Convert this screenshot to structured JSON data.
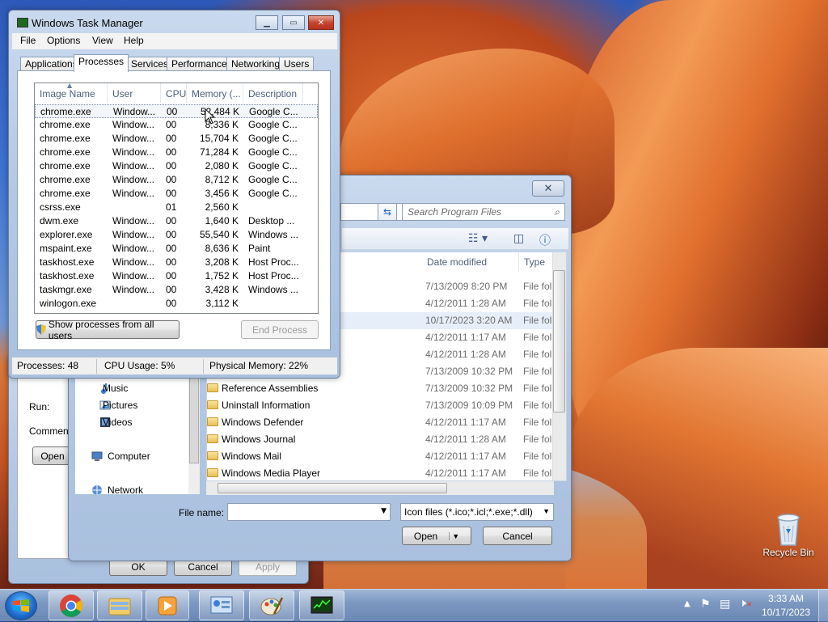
{
  "desktop": {
    "recycle_bin_label": "Recycle Bin"
  },
  "taskbar": {
    "apps": [
      {
        "icon": "chrome-icon"
      },
      {
        "icon": "explorer-folder-icon"
      },
      {
        "icon": "media-player-icon"
      },
      {
        "icon": "control-panel-icon"
      },
      {
        "icon": "paint-icon"
      },
      {
        "icon": "task-manager-icon"
      }
    ],
    "clock_time": "3:33 AM",
    "clock_date": "10/17/2023"
  },
  "task_manager": {
    "title": "Windows Task Manager",
    "menu": [
      "File",
      "Options",
      "View",
      "Help"
    ],
    "tabs": [
      "Applications",
      "Processes",
      "Services",
      "Performance",
      "Networking",
      "Users"
    ],
    "active_tab": "Processes",
    "columns": [
      "Image Name",
      "User Name",
      "CPU",
      "Memory (...",
      "Description"
    ],
    "processes": [
      [
        "chrome.exe",
        "Window...",
        "00",
        "52,484 K",
        "Google C..."
      ],
      [
        "chrome.exe",
        "Window...",
        "00",
        "8,336 K",
        "Google C..."
      ],
      [
        "chrome.exe",
        "Window...",
        "00",
        "15,704 K",
        "Google C..."
      ],
      [
        "chrome.exe",
        "Window...",
        "00",
        "71,284 K",
        "Google C..."
      ],
      [
        "chrome.exe",
        "Window...",
        "00",
        "2,080 K",
        "Google C..."
      ],
      [
        "chrome.exe",
        "Window...",
        "00",
        "8,712 K",
        "Google C..."
      ],
      [
        "chrome.exe",
        "Window...",
        "00",
        "3,456 K",
        "Google C..."
      ],
      [
        "csrss.exe",
        "",
        "01",
        "2,560 K",
        ""
      ],
      [
        "dwm.exe",
        "Window...",
        "00",
        "1,640 K",
        "Desktop ..."
      ],
      [
        "explorer.exe",
        "Window...",
        "00",
        "55,540 K",
        "Windows ..."
      ],
      [
        "mspaint.exe",
        "Window...",
        "00",
        "8,636 K",
        "Paint"
      ],
      [
        "taskhost.exe",
        "Window...",
        "00",
        "3,208 K",
        "Host Proc..."
      ],
      [
        "taskhost.exe",
        "Window...",
        "00",
        "1,752 K",
        "Host Proc..."
      ],
      [
        "taskmgr.exe",
        "Window...",
        "00",
        "3,428 K",
        "Windows ..."
      ],
      [
        "winlogon.exe",
        "",
        "00",
        "3,112 K",
        ""
      ]
    ],
    "show_all_label": "Show processes from all users",
    "end_process_label": "End Process",
    "status": {
      "processes": "Processes: 48",
      "cpu": "CPU Usage: 5%",
      "memory": "Physical Memory: 22%"
    }
  },
  "open_dialog": {
    "search_placeholder": "Search Program Files",
    "columns": [
      "Date modified",
      "Type"
    ],
    "rows": [
      {
        "name": "",
        "date": "7/13/2009 8:20 PM",
        "type": "File fol"
      },
      {
        "name": "",
        "date": "4/12/2011 1:28 AM",
        "type": "File fol"
      },
      {
        "name": "",
        "date": "10/17/2023 3:20 AM",
        "type": "File fol"
      },
      {
        "name": "",
        "date": "4/12/2011 1:17 AM",
        "type": "File fol"
      },
      {
        "name": "",
        "date": "4/12/2011 1:28 AM",
        "type": "File fol"
      },
      {
        "name": "",
        "date": "7/13/2009 10:32 PM",
        "type": "File fol"
      },
      {
        "name": "Reference Assemblies",
        "date": "7/13/2009 10:32 PM",
        "type": "File fol"
      },
      {
        "name": "Uninstall Information",
        "date": "7/13/2009 10:09 PM",
        "type": "File fol"
      },
      {
        "name": "Windows Defender",
        "date": "4/12/2011 1:17 AM",
        "type": "File fol"
      },
      {
        "name": "Windows Journal",
        "date": "4/12/2011 1:28 AM",
        "type": "File fol"
      },
      {
        "name": "Windows Mail",
        "date": "4/12/2011 1:17 AM",
        "type": "File fol"
      },
      {
        "name": "Windows Media Player",
        "date": "4/12/2011 1:17 AM",
        "type": "File fol"
      }
    ],
    "nav_items": [
      "Music",
      "Pictures",
      "Videos",
      "Computer",
      "Network"
    ],
    "file_name_label": "File name:",
    "file_name_value": "",
    "file_type_value": "Icon files (*.ico;*.icl;*.exe;*.dll)",
    "open_label": "Open",
    "cancel_label": "Cancel"
  },
  "run_dialog": {
    "run_label": "Run:",
    "comment_label": "Commen",
    "open_btn_label": "Open",
    "ok_label": "OK",
    "cancel_label": "Cancel",
    "apply_label": "Apply"
  }
}
